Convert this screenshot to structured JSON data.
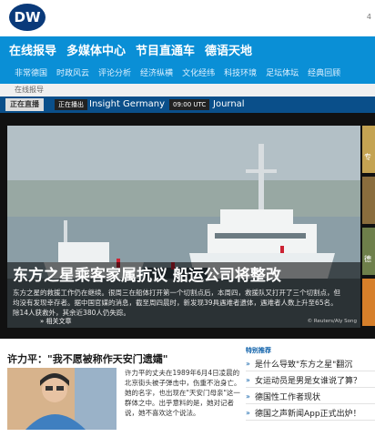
{
  "header": {
    "logo_text": "DW",
    "right_text": "4"
  },
  "nav": {
    "top_items": [
      "在线报导",
      "多媒体中心",
      "节目直通车",
      "德语天地"
    ],
    "sub_items": [
      "非常德国",
      "时政风云",
      "评论分析",
      "经济纵横",
      "文化经纬",
      "科技环境",
      "足坛体坛",
      "经典回顾"
    ]
  },
  "breadcrumb": "在线报导",
  "ticker": {
    "live_label": "正在直播",
    "now_tag": "正在播出",
    "now_program": "Insight Germany",
    "next_tag": "09:00 UTC",
    "next_program": "Journal"
  },
  "feature": {
    "headline": "东方之星乘客家属抗议 船运公司将整改",
    "summary": "东方之星的救援工作仍在继续。很周三在船体打开第一个切割点后，本周四，救援队又打开了三个切割点，但均没有发现幸存者。据中国官媒的消息，截至周四晨时，新发现39具遇难者遗体，遇难者人数上升至65名。除14人获救外，其余近380人仍失踪。",
    "more": "» 相关文章",
    "credit": "© Reuters/Aly Song",
    "side_items": [
      "专",
      "德"
    ]
  },
  "story": {
    "title": "许力平：\"我不愿被称作天安门遗孀\"",
    "text": "许力平的丈夫在1989年6月4日凌晨的北京街头被子弹击中，伤重不治身亡。她的名字，也出现在\"天安门母亲\"这一群体之中。出乎意料的是，她对记者说，她不喜欢这个说法。"
  },
  "special": {
    "label": "特别推荐",
    "items": [
      "是什么导致\"东方之星\"翻沉",
      "女运动员是男是女谁说了算？",
      "德国性工作者现状",
      "德国之声新闻App正式出炉！"
    ]
  },
  "colors": {
    "brand": "#0a8fd6",
    "ticker": "#0a4f8a",
    "logo": "#0a3a7a"
  }
}
